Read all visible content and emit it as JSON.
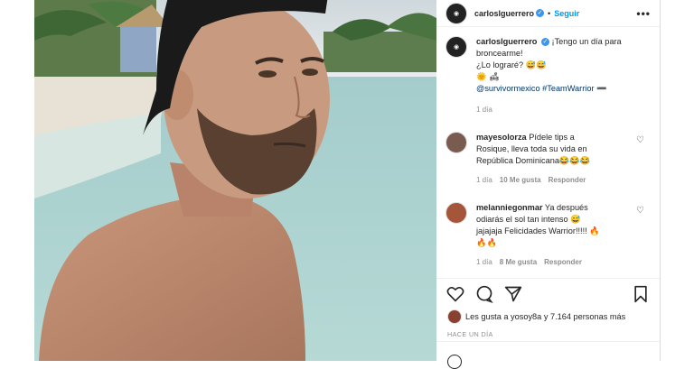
{
  "post": {
    "author": "carloslguerrero",
    "follow_label": "Seguir",
    "more_label": "•••",
    "caption_lines": [
      "¡Tengo un día para",
      "broncearme!",
      "¿Lo lograré? 😅😅",
      "🌞 🛋",
      "@survivormexico #TeamWarrior ➖"
    ],
    "caption_time": "1 día",
    "comments": [
      {
        "user": "mayesolorza",
        "lines": [
          "Pídele tips a",
          "Rosique, lleva toda su vida en",
          "República Dominicana😂😂😂"
        ],
        "time": "1 día",
        "likes": "10 Me gusta",
        "reply": "Responder"
      },
      {
        "user": "melanniegonmar",
        "lines": [
          "Ya después",
          "odiarás el sol tan intenso 😅",
          "jajajaja Felicidades Warrior!!!!! 🔥",
          "🔥🔥"
        ],
        "time": "1 día",
        "likes": "8 Me gusta",
        "reply": "Responder"
      }
    ],
    "likes_text": "Les gusta a yosoy8a y 7.164 personas más",
    "posted_ago": "HACE UN DÍA"
  },
  "colors": {
    "link": "#0095f6",
    "verified": "#3897f0",
    "muted": "#8e8e8e",
    "text": "#262626"
  },
  "icons": [
    "more-icon",
    "heart-icon",
    "comment-icon",
    "share-icon",
    "bookmark-icon",
    "verified-icon"
  ]
}
